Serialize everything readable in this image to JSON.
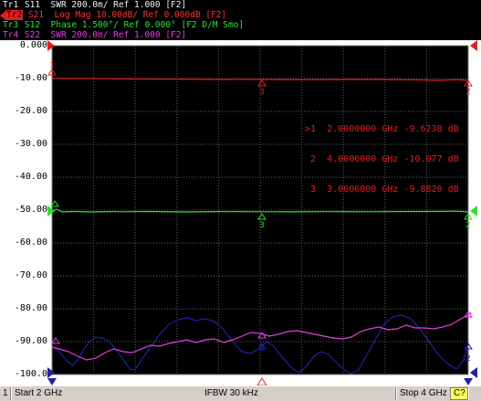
{
  "traces": [
    {
      "id": "Tr1",
      "text": "S11  SWR 200.0m/ Ref 1.000 [F2]",
      "color": "#f0f0f0",
      "highlight": false
    },
    {
      "id": "Tr2",
      "text": "S21  Log Mag 10.00dB/ Ref 0.000dB [F2]",
      "color": "#ff3030",
      "highlight": true
    },
    {
      "id": "Tr3",
      "text": "S12  Phase 1.500°/ Ref 0.000° [F2 D/M Smo]",
      "color": "#30e030",
      "highlight": false
    },
    {
      "id": "Tr4",
      "text": "S22  SWR 200.0m/ Ref 1.000 [F2]",
      "color": "#e040e0",
      "highlight": false
    }
  ],
  "y_axis_labels": [
    "0.000",
    "-10.00",
    "-20.00",
    "-30.00",
    "-40.00",
    "-50.00",
    "-60.00",
    "-70.00",
    "-80.00",
    "-90.00",
    "-100.0"
  ],
  "markers": [
    {
      "active": ">",
      "num": "1",
      "freq": "2.0000000 GHz",
      "value": "-9.6238 dB"
    },
    {
      "active": " ",
      "num": "2",
      "freq": "4.0000000 GHz",
      "value": "-10.077 dB"
    },
    {
      "active": " ",
      "num": "3",
      "freq": "3.0000000 GHz",
      "value": "-9.8820 dB"
    }
  ],
  "status_bar": {
    "channel": "1",
    "start": "Start 2 GHz",
    "ifbw": "IFBW 30 kHz",
    "stop": "Stop 4 GHz",
    "badge": "C?"
  },
  "colors": {
    "grid_bg": "#000000",
    "grid_line": "#606060",
    "tr1": "#2020a0",
    "tr2": "#e02020",
    "tr3": "#30e030",
    "tr4": "#e040e0"
  }
}
